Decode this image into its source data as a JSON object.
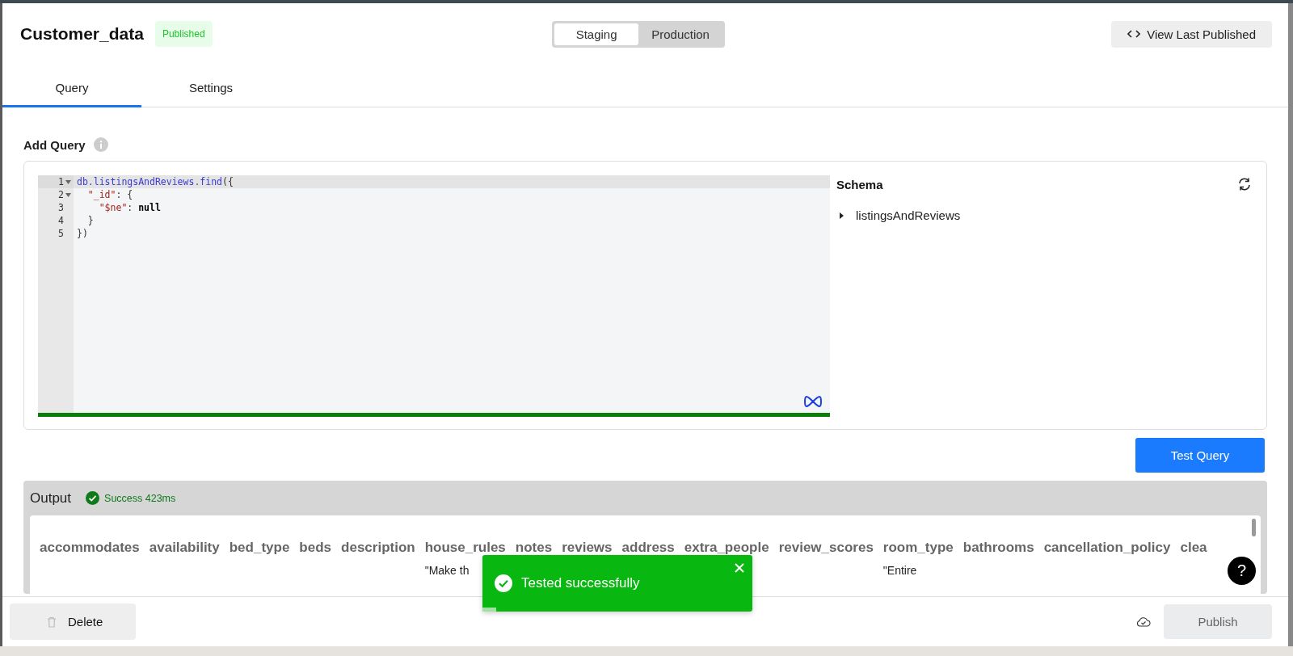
{
  "header": {
    "title": "Customer_data",
    "status": "Published",
    "environments": [
      {
        "label": "Staging",
        "selected": true
      },
      {
        "label": "Production",
        "selected": false
      }
    ],
    "view_button": "View Last Published"
  },
  "tabs": [
    {
      "label": "Query",
      "selected": true
    },
    {
      "label": "Settings",
      "selected": false
    }
  ],
  "query": {
    "label": "Add Query",
    "lines": [
      {
        "number": "1",
        "foldable": true,
        "active": true,
        "tokens": [
          {
            "kind": "ident",
            "text": "db.listingsAndReviews.find"
          },
          {
            "kind": "punct",
            "text": "({"
          }
        ]
      },
      {
        "number": "2",
        "foldable": true,
        "active": false,
        "tokens": [
          {
            "kind": "string",
            "text": "  \"_id\""
          },
          {
            "kind": "punct",
            "text": ": {"
          }
        ]
      },
      {
        "number": "3",
        "foldable": false,
        "active": false,
        "tokens": [
          {
            "kind": "string",
            "text": "    \"$ne\""
          },
          {
            "kind": "punct",
            "text": ": "
          },
          {
            "kind": "keyword",
            "text": "null"
          }
        ]
      },
      {
        "number": "4",
        "foldable": false,
        "active": false,
        "tokens": [
          {
            "kind": "punct",
            "text": "  }"
          }
        ]
      },
      {
        "number": "5",
        "foldable": false,
        "active": false,
        "tokens": [
          {
            "kind": "punct",
            "text": "})"
          }
        ]
      }
    ],
    "schema": {
      "title": "Schema",
      "items": [
        {
          "label": "listingsAndReviews",
          "expanded": false
        }
      ]
    },
    "test_button": "Test Query"
  },
  "output": {
    "label": "Output",
    "status": "Success 423ms",
    "columns": [
      {
        "header": "accommodates"
      },
      {
        "header": "availability"
      },
      {
        "header": "bed_type"
      },
      {
        "header": "beds"
      },
      {
        "header": "description"
      },
      {
        "header": "house_rules",
        "cell": "\"Make th"
      },
      {
        "header": "notes"
      },
      {
        "header": "reviews"
      },
      {
        "header": "address"
      },
      {
        "header": "extra_people"
      },
      {
        "header": "review_scores"
      },
      {
        "header": "room_type",
        "cell": "\"Entire"
      },
      {
        "header": "bathrooms"
      },
      {
        "header": "cancellation_policy"
      },
      {
        "header": "clea"
      }
    ]
  },
  "toast": {
    "message": "Tested successfully",
    "level": 0.05
  },
  "help_button": "?",
  "footer": {
    "delete_button": "Delete",
    "publish_button": "Publish",
    "publish_disabled": true
  }
}
